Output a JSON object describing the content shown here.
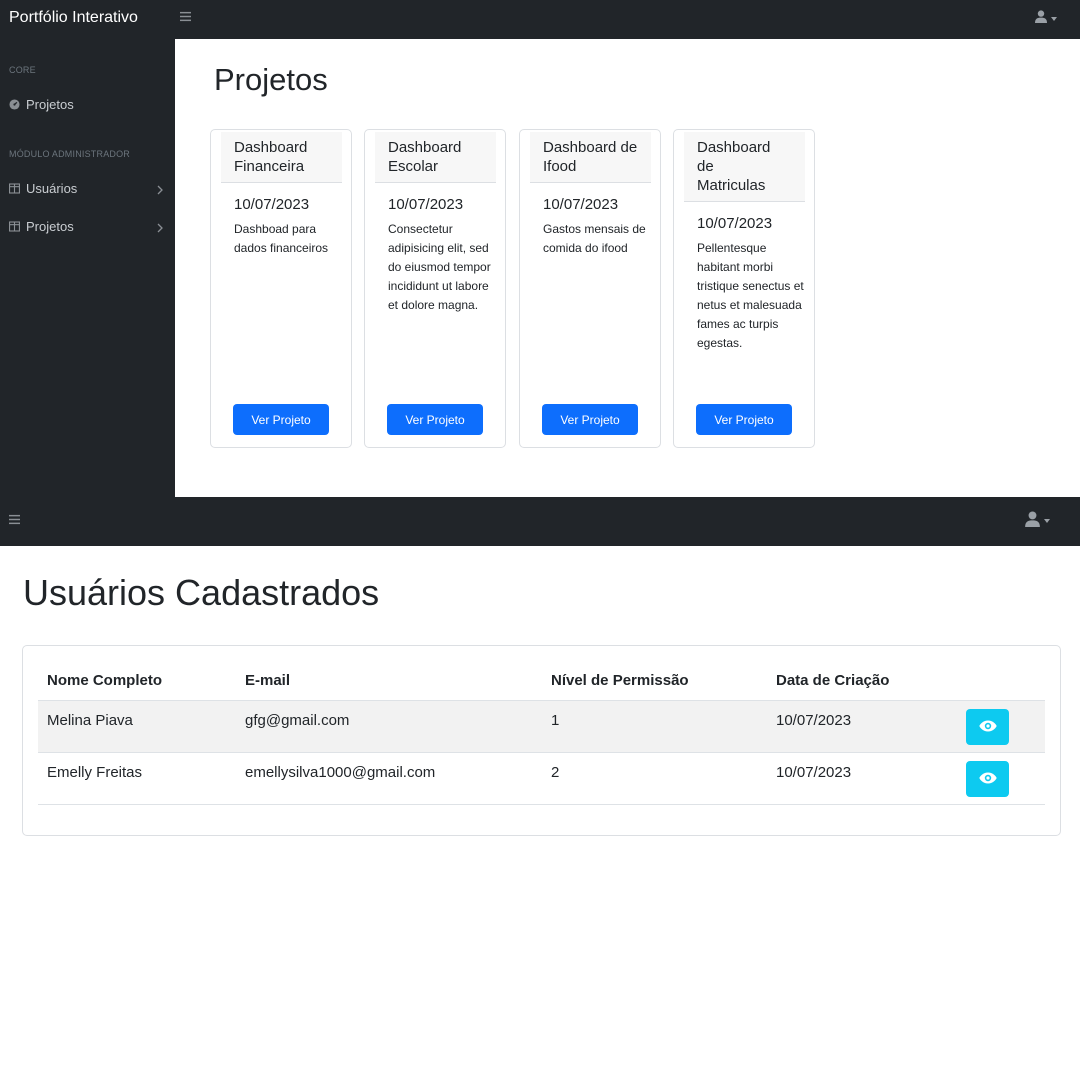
{
  "portfolio": {
    "brand": "Portfólio Interativo",
    "sidebar": {
      "sections": [
        {
          "heading": "CORE",
          "links": [
            {
              "label": "Projetos",
              "icon": "gauge-icon",
              "expandable": false
            }
          ]
        },
        {
          "heading": "MÓDULO ADMINISTRADOR",
          "links": [
            {
              "label": "Usuários",
              "icon": "columns-icon",
              "expandable": true
            },
            {
              "label": "Projetos",
              "icon": "columns-icon",
              "expandable": true
            }
          ]
        }
      ]
    },
    "page_title": "Projetos",
    "cards": [
      {
        "title": "Dashboard Financeira",
        "date": "10/07/2023",
        "description": "Dashboad para dados financeiros",
        "button": "Ver Projeto"
      },
      {
        "title": "Dashboard Escolar",
        "date": "10/07/2023",
        "description": "Consectetur adipisicing elit, sed do eiusmod tempor incididunt ut labore et dolore magna.",
        "button": "Ver Projeto"
      },
      {
        "title": "Dashboard de Ifood",
        "date": "10/07/2023",
        "description": "Gastos mensais de comida do ifood",
        "button": "Ver Projeto"
      },
      {
        "title": "Dashboard de Matriculas",
        "date": "10/07/2023",
        "description": "Pellentesque habitant morbi tristique senectus et netus et malesuada fames ac turpis egestas.",
        "button": "Ver Projeto"
      }
    ]
  },
  "users_page": {
    "page_title": "Usuários Cadastrados",
    "table": {
      "columns": [
        "Nome Completo",
        "E-mail",
        "Nível de Permissão",
        "Data de Criação"
      ],
      "rows": [
        {
          "name": "Melina Piava",
          "email": "gfg@gmail.com",
          "level": "1",
          "created": "10/07/2023"
        },
        {
          "name": "Emelly Freitas",
          "email": "emellysilva1000@gmail.com",
          "level": "2",
          "created": "10/07/2023"
        }
      ]
    }
  },
  "colors": {
    "navbar": "#212529",
    "primary_button": "#0d6efd",
    "info_button": "#0dcaf0",
    "card_header": "#f7f7f7",
    "striped_row": "#f2f2f2"
  }
}
